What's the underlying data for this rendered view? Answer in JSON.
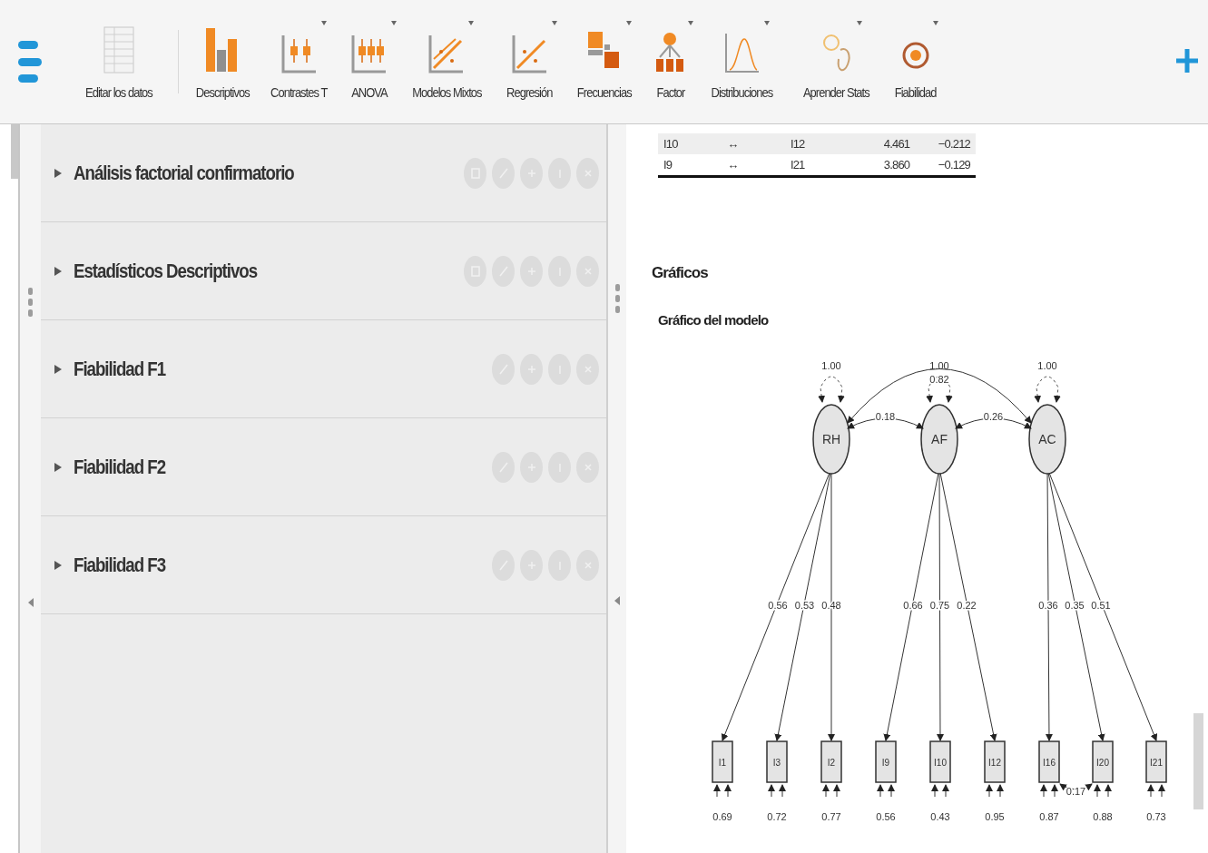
{
  "toolbar": {
    "items": [
      {
        "label": "Editar los datos",
        "kind": "data",
        "dropdown": false
      },
      {
        "label": "Descriptivos",
        "kind": "bars",
        "dropdown": false
      },
      {
        "label": "Contrastes T",
        "kind": "ttest",
        "dropdown": true
      },
      {
        "label": "ANOVA",
        "kind": "anova",
        "dropdown": true
      },
      {
        "label": "Modelos Mixtos",
        "kind": "mixed",
        "dropdown": true
      },
      {
        "label": "Regresión",
        "kind": "regression",
        "dropdown": true
      },
      {
        "label": "Frecuencias",
        "kind": "frequencies",
        "dropdown": true
      },
      {
        "label": "Factor",
        "kind": "factor",
        "dropdown": true
      },
      {
        "label": "Distribuciones",
        "kind": "distribution",
        "dropdown": true
      },
      {
        "label": "Aprender Stats",
        "kind": "learn",
        "dropdown": true
      },
      {
        "label": "Fiabilidad",
        "kind": "reliability",
        "dropdown": true
      }
    ]
  },
  "analyses": [
    {
      "title": "Análisis factorial confirmatorio",
      "expanded": false,
      "buttons": [
        {
          "kind": "duplicate"
        },
        {
          "kind": "edit"
        },
        {
          "kind": "copy"
        },
        {
          "kind": "info"
        },
        {
          "kind": "remove"
        }
      ]
    },
    {
      "title": "Estadísticos Descriptivos",
      "expanded": false,
      "buttons": [
        {
          "kind": "duplicate"
        },
        {
          "kind": "edit"
        },
        {
          "kind": "copy"
        },
        {
          "kind": "info"
        },
        {
          "kind": "remove"
        }
      ]
    },
    {
      "title": "Fiabilidad F1",
      "expanded": false,
      "buttons": [
        {
          "kind": "edit"
        },
        {
          "kind": "copy"
        },
        {
          "kind": "info"
        },
        {
          "kind": "remove"
        }
      ]
    },
    {
      "title": "Fiabilidad F2",
      "expanded": false,
      "buttons": [
        {
          "kind": "edit"
        },
        {
          "kind": "copy"
        },
        {
          "kind": "info"
        },
        {
          "kind": "remove"
        }
      ]
    },
    {
      "title": "Fiabilidad F3",
      "expanded": false,
      "buttons": [
        {
          "kind": "edit"
        },
        {
          "kind": "copy"
        },
        {
          "kind": "info"
        },
        {
          "kind": "remove"
        }
      ]
    }
  ],
  "results": {
    "table": {
      "rows": [
        {
          "cells": [
            "I10",
            "↔",
            "I12",
            "4.461",
            "−0.212"
          ],
          "highlighted": true
        },
        {
          "cells": [
            "I9",
            "↔",
            "I21",
            "3.860",
            "−0.129"
          ],
          "highlighted": false
        }
      ]
    },
    "heading": "Gráficos",
    "subheading": "Gráfico del modelo",
    "diagram": {
      "factors": [
        {
          "label": "RH",
          "variance": "1.00",
          "indicators": [
            {
              "label": "I1",
              "loading": "0.56",
              "residual": "0.69"
            },
            {
              "label": "I3",
              "loading": "0.53",
              "residual": "0.72"
            },
            {
              "label": "I2",
              "loading": "0.48",
              "residual": "0.77"
            }
          ]
        },
        {
          "label": "AF",
          "variance": "1.00",
          "indicators": [
            {
              "label": "I9",
              "loading": "0.66",
              "residual": "0.56"
            },
            {
              "label": "I10",
              "loading": "0.75",
              "residual": "0.43"
            },
            {
              "label": "I12",
              "loading": "0.22",
              "residual": "0.95"
            }
          ]
        },
        {
          "label": "AC",
          "variance": "1.00",
          "indicators": [
            {
              "label": "I16",
              "loading": "0.36",
              "residual": "0.87"
            },
            {
              "label": "I20",
              "loading": "0.35",
              "residual": "0.88"
            },
            {
              "label": "I21",
              "loading": "0.51",
              "residual": "0.73"
            }
          ]
        }
      ],
      "covariances": [
        {
          "value": "0.18"
        },
        {
          "value": "0.26"
        },
        {
          "value": "0.82"
        }
      ],
      "residual_covariances": [
        {
          "value": "0.17"
        }
      ]
    }
  }
}
